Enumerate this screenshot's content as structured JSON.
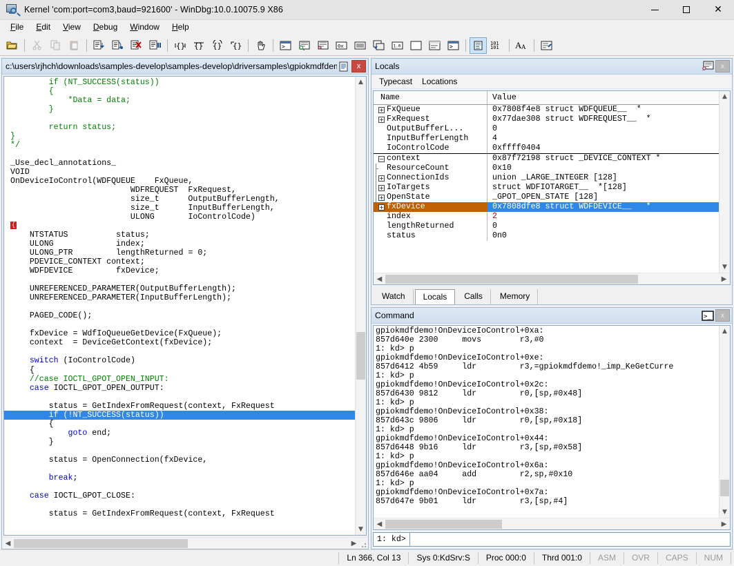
{
  "window": {
    "title": "Kernel 'com:port=com3,baud=921600' - WinDbg:10.0.10075.9 X86",
    "icon": "windbg-app-icon",
    "minimize_label": "—",
    "maximize_label": "☐",
    "close_label": "✕"
  },
  "menu": {
    "items": [
      {
        "label": "File",
        "accel": "F"
      },
      {
        "label": "Edit",
        "accel": "E"
      },
      {
        "label": "View",
        "accel": "V"
      },
      {
        "label": "Debug",
        "accel": "D"
      },
      {
        "label": "Window",
        "accel": "W"
      },
      {
        "label": "Help",
        "accel": "H"
      }
    ]
  },
  "toolbar": {
    "buttons": [
      {
        "name": "open-source-file-icon",
        "enabled": true
      },
      {
        "name": "cut-icon",
        "enabled": false
      },
      {
        "name": "copy-icon",
        "enabled": false
      },
      {
        "name": "paste-icon",
        "enabled": false
      },
      {
        "name": "step-into-icon",
        "enabled": true
      },
      {
        "name": "step-over-icon",
        "enabled": true
      },
      {
        "name": "step-out-icon",
        "enabled": true
      },
      {
        "name": "run-to-cursor-icon",
        "enabled": true
      },
      {
        "name": "go-icon",
        "enabled": true
      },
      {
        "name": "restart-icon",
        "enabled": true
      },
      {
        "name": "stop-debugging-icon",
        "enabled": true
      },
      {
        "name": "break-icon",
        "enabled": true
      },
      {
        "name": "break-hand-icon",
        "enabled": true
      },
      {
        "name": "command-window-icon",
        "enabled": true
      },
      {
        "name": "watch-window-icon",
        "enabled": true
      },
      {
        "name": "locals-window-icon",
        "enabled": true
      },
      {
        "name": "registers-window-icon",
        "enabled": true
      },
      {
        "name": "memory-window-icon",
        "enabled": true
      },
      {
        "name": "call-stack-window-icon",
        "enabled": true
      },
      {
        "name": "disassembly-window-icon",
        "enabled": true
      },
      {
        "name": "scratch-pad-icon",
        "enabled": true
      },
      {
        "name": "processes-threads-icon",
        "enabled": true
      },
      {
        "name": "command-browser-icon",
        "enabled": true
      },
      {
        "name": "source-mode-icon",
        "enabled": true,
        "active": true
      },
      {
        "name": "numbers-101-icon",
        "enabled": true
      },
      {
        "name": "font-icon",
        "enabled": true
      },
      {
        "name": "options-icon",
        "enabled": true
      }
    ]
  },
  "source_window": {
    "title": "c:\\users\\rjhch\\downloads\\samples-develop\\samples-develop\\driversamples\\gpiokmdfdem",
    "restore_icon": "restore-window-icon",
    "close_label": "x",
    "lines": [
      {
        "segs": [
          {
            "t": "        if (NT_SUCCESS(status))",
            "c": "grn"
          }
        ]
      },
      {
        "segs": [
          {
            "t": "        {",
            "c": "grn"
          }
        ]
      },
      {
        "segs": [
          {
            "t": "            *Data = data;",
            "c": "grn"
          }
        ]
      },
      {
        "segs": [
          {
            "t": "        }",
            "c": "grn"
          }
        ]
      },
      {
        "segs": [
          {
            "t": "",
            "c": ""
          }
        ]
      },
      {
        "segs": [
          {
            "t": "        return status;",
            "c": "grn"
          }
        ]
      },
      {
        "segs": [
          {
            "t": "}",
            "c": "grn"
          }
        ]
      },
      {
        "segs": [
          {
            "t": "*/",
            "c": "grn"
          }
        ]
      },
      {
        "segs": [
          {
            "t": "",
            "c": ""
          }
        ]
      },
      {
        "segs": [
          {
            "t": "_Use_decl_annotations_",
            "c": ""
          }
        ]
      },
      {
        "segs": [
          {
            "t": "VOID",
            "c": ""
          }
        ]
      },
      {
        "segs": [
          {
            "t": "OnDeviceIoControl(WDFQUEUE    FxQueue,",
            "c": ""
          }
        ]
      },
      {
        "segs": [
          {
            "t": "                         WDFREQUEST  FxRequest,",
            "c": ""
          }
        ]
      },
      {
        "segs": [
          {
            "t": "                         size_t      OutputBufferLength,",
            "c": ""
          }
        ]
      },
      {
        "segs": [
          {
            "t": "                         size_t      InputBufferLength,",
            "c": ""
          }
        ]
      },
      {
        "segs": [
          {
            "t": "                         ULONG       IoControlCode)",
            "c": ""
          }
        ]
      },
      {
        "segs": [
          {
            "t": "{",
            "c": ""
          }
        ],
        "breakpoint": true
      },
      {
        "segs": [
          {
            "t": "    NTSTATUS          status;",
            "c": ""
          }
        ]
      },
      {
        "segs": [
          {
            "t": "    ULONG             index;",
            "c": ""
          }
        ]
      },
      {
        "segs": [
          {
            "t": "    ULONG_PTR         lengthReturned = 0;",
            "c": ""
          }
        ]
      },
      {
        "segs": [
          {
            "t": "    PDEVICE_CONTEXT context;",
            "c": ""
          }
        ]
      },
      {
        "segs": [
          {
            "t": "    WDFDEVICE         fxDevice;",
            "c": ""
          }
        ]
      },
      {
        "segs": [
          {
            "t": "",
            "c": ""
          }
        ]
      },
      {
        "segs": [
          {
            "t": "    UNREFERENCED_PARAMETER(OutputBufferLength);",
            "c": ""
          }
        ]
      },
      {
        "segs": [
          {
            "t": "    UNREFERENCED_PARAMETER(InputBufferLength);",
            "c": ""
          }
        ]
      },
      {
        "segs": [
          {
            "t": "",
            "c": ""
          }
        ]
      },
      {
        "segs": [
          {
            "t": "    PAGED_CODE();",
            "c": ""
          }
        ]
      },
      {
        "segs": [
          {
            "t": "",
            "c": ""
          }
        ]
      },
      {
        "segs": [
          {
            "t": "    fxDevice = WdfIoQueueGetDevice(FxQueue);",
            "c": ""
          }
        ]
      },
      {
        "segs": [
          {
            "t": "    context  = DeviceGetContext(fxDevice);",
            "c": ""
          }
        ]
      },
      {
        "segs": [
          {
            "t": "",
            "c": ""
          }
        ]
      },
      {
        "segs": [
          {
            "t": "    switch",
            "c": "kw"
          },
          {
            "t": " (IoControlCode)",
            "c": ""
          }
        ]
      },
      {
        "segs": [
          {
            "t": "    {",
            "c": ""
          }
        ]
      },
      {
        "segs": [
          {
            "t": "    //case IOCTL_GPOT_OPEN_INPUT:",
            "c": "grn"
          }
        ]
      },
      {
        "segs": [
          {
            "t": "    case",
            "c": "kw"
          },
          {
            "t": " IOCTL_GPOT_OPEN_OUTPUT:",
            "c": ""
          }
        ]
      },
      {
        "segs": [
          {
            "t": "",
            "c": ""
          }
        ]
      },
      {
        "segs": [
          {
            "t": "        status = GetIndexFromRequest(context, FxRequest",
            "c": ""
          }
        ]
      },
      {
        "segs": [
          {
            "t": "        if (!NT_SUCCESS(status))",
            "c": ""
          }
        ],
        "highlight": true
      },
      {
        "segs": [
          {
            "t": "        {",
            "c": ""
          }
        ]
      },
      {
        "segs": [
          {
            "t": "            goto",
            "c": "kw"
          },
          {
            "t": " end;",
            "c": ""
          }
        ]
      },
      {
        "segs": [
          {
            "t": "        }",
            "c": ""
          }
        ]
      },
      {
        "segs": [
          {
            "t": "",
            "c": ""
          }
        ]
      },
      {
        "segs": [
          {
            "t": "        status = OpenConnection(fxDevice,",
            "c": ""
          }
        ]
      },
      {
        "segs": [
          {
            "t": "",
            "c": ""
          }
        ]
      },
      {
        "segs": [
          {
            "t": "        break",
            "c": "kw"
          },
          {
            "t": ";",
            "c": ""
          }
        ]
      },
      {
        "segs": [
          {
            "t": "",
            "c": ""
          }
        ]
      },
      {
        "segs": [
          {
            "t": "    case",
            "c": "kw"
          },
          {
            "t": " IOCTL_GPOT_CLOSE:",
            "c": ""
          }
        ]
      },
      {
        "segs": [
          {
            "t": "",
            "c": ""
          }
        ]
      },
      {
        "segs": [
          {
            "t": "        status = GetIndexFromRequest(context, FxRequest",
            "c": ""
          }
        ]
      }
    ]
  },
  "locals_window": {
    "title": "Locals",
    "header_icon": "locals-settings-icon",
    "close_label": "x",
    "menu": [
      {
        "label": "Typecast"
      },
      {
        "label": "Locations"
      }
    ],
    "columns": [
      "Name",
      "Value"
    ],
    "rows": [
      {
        "name": "FxQueue",
        "value": "0x7808f4e8 struct WDFQUEUE__  *",
        "expander": "plus",
        "depth": 0
      },
      {
        "name": "FxRequest",
        "value": "0x77dae308 struct WDFREQUEST__  *",
        "expander": "plus",
        "depth": 0
      },
      {
        "name": "OutputBufferL...",
        "value": "0",
        "expander": "none",
        "depth": 0
      },
      {
        "name": "InputBufferLength",
        "value": "4",
        "expander": "none",
        "depth": 0
      },
      {
        "name": "IoControlCode",
        "value": "0xffff0404",
        "expander": "none",
        "depth": 0
      },
      {
        "name": "context",
        "value": "0x87f72198 struct _DEVICE_CONTEXT *",
        "expander": "minus",
        "depth": 0,
        "rule_above": true
      },
      {
        "name": "ResourceCount",
        "value": "0x10",
        "expander": "none",
        "depth": 1,
        "tree": "tee"
      },
      {
        "name": "ConnectionIds",
        "value": "union _LARGE_INTEGER [128]",
        "expander": "plus",
        "depth": 1,
        "tree": "bar"
      },
      {
        "name": "IoTargets",
        "value": "struct WDFIOTARGET__  *[128]",
        "expander": "plus",
        "depth": 1,
        "tree": "bar"
      },
      {
        "name": "OpenState",
        "value": "_GPOT_OPEN_STATE [128]",
        "expander": "plus",
        "depth": 1,
        "tree": "bar"
      },
      {
        "name": "fxDevice",
        "value": "0x7808dfe8 struct WDFDEVICE__   *",
        "expander": "plus",
        "depth": 0,
        "selected": true
      },
      {
        "name": "index",
        "value": "2",
        "expander": "none",
        "depth": 0,
        "value_color": "red"
      },
      {
        "name": "lengthReturned",
        "value": "0",
        "expander": "none",
        "depth": 0
      },
      {
        "name": "status",
        "value": "0n0",
        "expander": "none",
        "depth": 0
      }
    ],
    "tabs": [
      {
        "label": "Watch",
        "active": false
      },
      {
        "label": "Locals",
        "active": true
      },
      {
        "label": "Calls",
        "active": false
      },
      {
        "label": "Memory",
        "active": false
      }
    ]
  },
  "command_window": {
    "title": "Command",
    "header_icon": "command-prompt-icon",
    "close_label": "x",
    "output": [
      "gpiokmdfdemo!OnDeviceIoControl+0xa:",
      "857d640e 2300     movs        r3,#0",
      "1: kd> p",
      "gpiokmdfdemo!OnDeviceIoControl+0xe:",
      "857d6412 4b59     ldr         r3,=gpiokmdfdemo!_imp_KeGetCurre",
      "1: kd> p",
      "gpiokmdfdemo!OnDeviceIoControl+0x2c:",
      "857d6430 9812     ldr         r0,[sp,#0x48]",
      "1: kd> p",
      "gpiokmdfdemo!OnDeviceIoControl+0x38:",
      "857d643c 9806     ldr         r0,[sp,#0x18]",
      "1: kd> p",
      "gpiokmdfdemo!OnDeviceIoControl+0x44:",
      "857d6448 9b16     ldr         r3,[sp,#0x58]",
      "1: kd> p",
      "gpiokmdfdemo!OnDeviceIoControl+0x6a:",
      "857d646e aa04     add         r2,sp,#0x10",
      "1: kd> p",
      "gpiokmdfdemo!OnDeviceIoControl+0x7a:",
      "857d647e 9b01     ldr         r3,[sp,#4]"
    ],
    "prompt": "1: kd>",
    "input_value": "",
    "input_placeholder": ""
  },
  "statusbar": {
    "cells": [
      {
        "label": "Ln 366, Col 13",
        "dim": false
      },
      {
        "label": "Sys 0:KdSrv:S",
        "dim": false
      },
      {
        "label": "Proc 000:0",
        "dim": false
      },
      {
        "label": "Thrd 001:0",
        "dim": false
      },
      {
        "label": "ASM",
        "dim": true
      },
      {
        "label": "OVR",
        "dim": true
      },
      {
        "label": "CAPS",
        "dim": true
      },
      {
        "label": "NUM",
        "dim": true
      }
    ]
  },
  "colors": {
    "accent_selection": "#2f87e8",
    "selected_name": "#c06000",
    "breakpoint": "#cf1f1f",
    "comment_green": "#008000",
    "keyword_blue": "#0000c8",
    "mdi_close_red": "#c9483f"
  }
}
